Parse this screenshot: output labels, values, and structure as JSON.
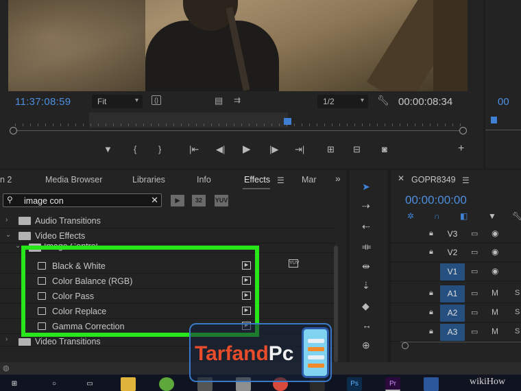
{
  "program_monitor": {
    "timecode_in": "11:37:08:59",
    "fit_select": "Fit",
    "resolution_select": "1/2",
    "timecode_duration": "00:00:08:34",
    "transport_icons": [
      "add-marker-icon",
      "mark-in-icon",
      "mark-out-icon",
      "go-to-in-icon",
      "step-back-icon",
      "play-icon",
      "step-forward-icon",
      "go-to-out-icon",
      "lift-icon",
      "extract-icon",
      "export-frame-icon",
      "button-editor-icon"
    ]
  },
  "source_monitor": {
    "timecode": "00"
  },
  "effects_panel": {
    "tabs": [
      "n 2",
      "Media Browser",
      "Libraries",
      "Info",
      "Effects",
      "Mar"
    ],
    "active_tab": "Effects",
    "overflow_label": "»",
    "search": {
      "value": "image con",
      "clear": "✕"
    },
    "filter_badges": [
      "▶",
      "32",
      "YUV"
    ],
    "tree": [
      {
        "label": "Audio Transitions",
        "expanded": false
      },
      {
        "label": "Video Effects",
        "expanded": true
      },
      {
        "label": "Image Control",
        "expanded": true,
        "indent": 1
      },
      {
        "label": "Black & White",
        "effect": true
      },
      {
        "label": "Color Balance (RGB)",
        "effect": true
      },
      {
        "label": "Color Pass",
        "effect": true
      },
      {
        "label": "Color Replace",
        "effect": true
      },
      {
        "label": "Gamma Correction",
        "effect": true
      },
      {
        "label": "Video Transitions",
        "expanded": false
      }
    ],
    "highlight_color": "#27e61a"
  },
  "tools_panel": {
    "tools": [
      "selection-tool-icon",
      "track-select-icon",
      "ripple-edit-icon",
      "rolling-edit-icon",
      "rate-stretch-icon",
      "razor-icon",
      "slip-icon",
      "slide-icon",
      "pen-icon"
    ]
  },
  "timeline": {
    "sequence_name": "GOPR8349",
    "timecode": "00:00:00:00",
    "tracks": [
      {
        "name": "V3",
        "targeted": false,
        "ic": "▭",
        "ic2": "◉",
        "ic3": ""
      },
      {
        "name": "V2",
        "targeted": false,
        "ic": "▭",
        "ic2": "◉",
        "ic3": ""
      },
      {
        "name": "V1",
        "targeted": true,
        "ic": "▭",
        "ic2": "◉",
        "ic3": ""
      },
      {
        "name": "A1",
        "targeted": true,
        "ic": "▭",
        "ic2": "M",
        "ic3": "S"
      },
      {
        "name": "A2",
        "targeted": true,
        "ic": "▭",
        "ic2": "M",
        "ic3": "S"
      },
      {
        "name": "A3",
        "targeted": true,
        "ic": "▭",
        "ic2": "M",
        "ic3": "S"
      }
    ]
  },
  "watermark": {
    "brand_part1": "Tarfand",
    "brand_part2": "Pc"
  },
  "wikihow": "wikiHow",
  "colors": {
    "accent_blue": "#4d8fe0",
    "highlight_green": "#27e61a",
    "track_target": "#254f7e"
  }
}
